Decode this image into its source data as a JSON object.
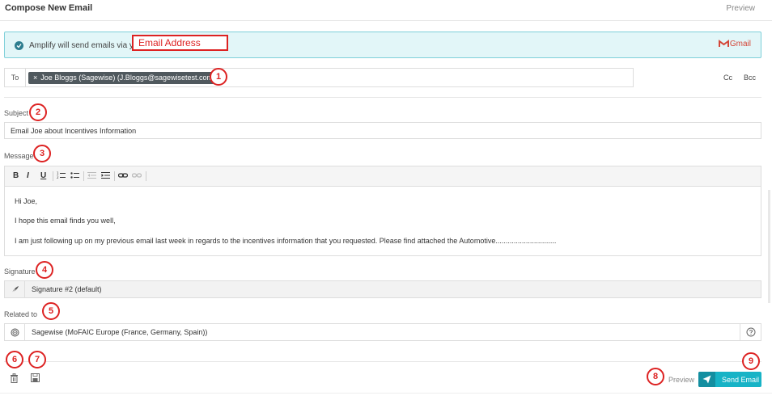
{
  "header": {
    "title": "Compose New Email",
    "preview_label": "Preview"
  },
  "banner": {
    "message": "Amplify will send emails via your",
    "highlight": "Email Address",
    "provider": "Gmail",
    "colors": {
      "background": "#e2f6f8",
      "border": "#7fd0d9",
      "highlight": "#dd2222"
    }
  },
  "to": {
    "label": "To",
    "recipient_chip": "Joe  Bloggs  (Sagewise)  (J.Bloggs@sagewisetest.com)",
    "remove_glyph": "×",
    "cc_label": "Cc",
    "bcc_label": "Bcc"
  },
  "subject": {
    "label": "Subject",
    "value": "Email Joe about Incentives Information"
  },
  "message": {
    "label": "Message",
    "toolbar": {
      "bold": "B",
      "italic": "I",
      "underline": "U"
    },
    "body": [
      "Hi Joe,",
      "I hope this email finds you well,",
      "I am just following up on my previous email last week in regards to the incentives information that you requested. Please find attached the Automotive.............................."
    ]
  },
  "signature": {
    "label": "Signature",
    "value": "Signature #2 (default)"
  },
  "related": {
    "label": "Related to",
    "value": "Sagewise (MoFAIC Europe (France, Germany, Spain))"
  },
  "footer": {
    "preview_label": "Preview",
    "send_label": "Send Email"
  },
  "markers": [
    "1",
    "2",
    "3",
    "4",
    "5",
    "6",
    "7",
    "8",
    "9"
  ],
  "icons": [
    "check-circle-icon",
    "gmail-icon",
    "bold-icon",
    "italic-icon",
    "underline-icon",
    "ordered-list-icon",
    "bullet-list-icon",
    "outdent-icon",
    "indent-icon",
    "link-icon",
    "unlink-icon",
    "feather-icon",
    "target-icon",
    "help-icon",
    "trash-icon",
    "save-icon",
    "paper-plane-icon"
  ],
  "colors": {
    "accent": "#17b3c6",
    "accent_dark": "#138ea0",
    "marker": "#dd2222",
    "chip": "#50595e"
  }
}
